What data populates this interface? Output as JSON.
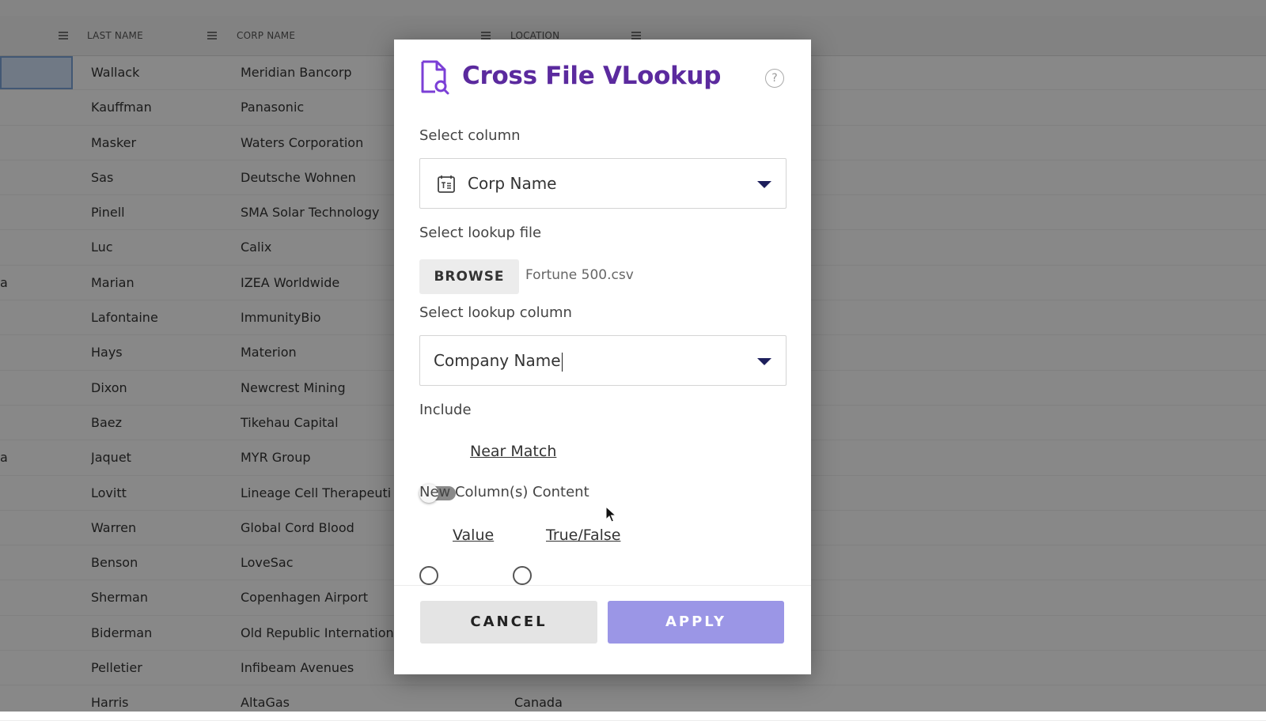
{
  "grid": {
    "columns": [
      {
        "key": "last_name",
        "label": "LAST NAME"
      },
      {
        "key": "corp_name",
        "label": "CORP NAME"
      },
      {
        "key": "location",
        "label": "LOCATION"
      }
    ],
    "rows": [
      {
        "first": "",
        "last": "Wallack",
        "corp": "Meridian Bancorp",
        "loc": ""
      },
      {
        "first": "",
        "last": "Kauffman",
        "corp": "Panasonic",
        "loc": ""
      },
      {
        "first": "",
        "last": "Masker",
        "corp": "Waters Corporation",
        "loc": ""
      },
      {
        "first": "",
        "last": "Sas",
        "corp": "Deutsche Wohnen",
        "loc": ""
      },
      {
        "first": "",
        "last": "Pinell",
        "corp": "SMA Solar Technology",
        "loc": ""
      },
      {
        "first": "",
        "last": "Luc",
        "corp": "Calix",
        "loc": ""
      },
      {
        "first": "a",
        "last": "Marian",
        "corp": "IZEA Worldwide",
        "loc": ""
      },
      {
        "first": "",
        "last": "Lafontaine",
        "corp": "ImmunityBio",
        "loc": ""
      },
      {
        "first": "",
        "last": "Hays",
        "corp": "Materion",
        "loc": ""
      },
      {
        "first": "",
        "last": "Dixon",
        "corp": "Newcrest Mining",
        "loc": ""
      },
      {
        "first": "",
        "last": "Baez",
        "corp": "Tikehau Capital",
        "loc": ""
      },
      {
        "first": "a",
        "last": "Jaquet",
        "corp": "MYR Group",
        "loc": ""
      },
      {
        "first": "",
        "last": "Lovitt",
        "corp": "Lineage Cell Therapeuti",
        "loc": ""
      },
      {
        "first": "",
        "last": "Warren",
        "corp": "Global Cord Blood",
        "loc": ""
      },
      {
        "first": "",
        "last": "Benson",
        "corp": "LoveSac",
        "loc": ""
      },
      {
        "first": "",
        "last": "Sherman",
        "corp": "Copenhagen Airport",
        "loc": ""
      },
      {
        "first": "",
        "last": "Biderman",
        "corp": "Old Republic Internation",
        "loc": ""
      },
      {
        "first": "",
        "last": "Pelletier",
        "corp": "Infibeam Avenues",
        "loc": ""
      },
      {
        "first": "",
        "last": "Harris",
        "corp": "AltaGas",
        "loc": "Canada"
      }
    ]
  },
  "dialog": {
    "title": "Cross File VLookup",
    "help_label": "?",
    "select_column_label": "Select column",
    "select_column_value": "Corp Name",
    "lookup_file_label": "Select lookup file",
    "browse_label": "BROWSE",
    "file_name": "Fortune 500.csv",
    "lookup_column_label": "Select lookup column",
    "lookup_column_value": "Company Name",
    "include_label": "Include",
    "near_match_label": "Near Match",
    "new_content_label": "New Column(s) Content",
    "radio_value_label": "Value",
    "radio_truefalse_label": "True/False",
    "cancel_label": "CANCEL",
    "apply_label": "APPLY"
  },
  "colors": {
    "title": "#5b2a9e",
    "apply_button": "#9b96e6",
    "caret": "#1d1f5c",
    "icon_purple": "#7b3fd6"
  },
  "icons": [
    "document-search-icon",
    "help-icon",
    "text-field-icon",
    "chevron-down-icon",
    "menu-icon",
    "mouse-pointer-icon"
  ]
}
